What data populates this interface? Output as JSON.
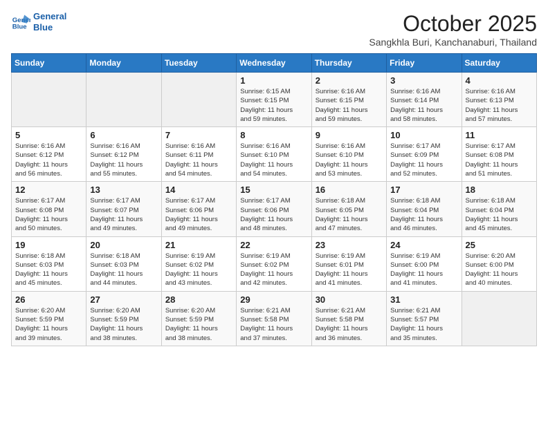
{
  "header": {
    "logo_line1": "General",
    "logo_line2": "Blue",
    "month_title": "October 2025",
    "location": "Sangkhla Buri, Kanchanaburi, Thailand"
  },
  "days_of_week": [
    "Sunday",
    "Monday",
    "Tuesday",
    "Wednesday",
    "Thursday",
    "Friday",
    "Saturday"
  ],
  "weeks": [
    [
      {
        "day": "",
        "info": ""
      },
      {
        "day": "",
        "info": ""
      },
      {
        "day": "",
        "info": ""
      },
      {
        "day": "1",
        "info": "Sunrise: 6:15 AM\nSunset: 6:15 PM\nDaylight: 11 hours\nand 59 minutes."
      },
      {
        "day": "2",
        "info": "Sunrise: 6:16 AM\nSunset: 6:15 PM\nDaylight: 11 hours\nand 59 minutes."
      },
      {
        "day": "3",
        "info": "Sunrise: 6:16 AM\nSunset: 6:14 PM\nDaylight: 11 hours\nand 58 minutes."
      },
      {
        "day": "4",
        "info": "Sunrise: 6:16 AM\nSunset: 6:13 PM\nDaylight: 11 hours\nand 57 minutes."
      }
    ],
    [
      {
        "day": "5",
        "info": "Sunrise: 6:16 AM\nSunset: 6:12 PM\nDaylight: 11 hours\nand 56 minutes."
      },
      {
        "day": "6",
        "info": "Sunrise: 6:16 AM\nSunset: 6:12 PM\nDaylight: 11 hours\nand 55 minutes."
      },
      {
        "day": "7",
        "info": "Sunrise: 6:16 AM\nSunset: 6:11 PM\nDaylight: 11 hours\nand 54 minutes."
      },
      {
        "day": "8",
        "info": "Sunrise: 6:16 AM\nSunset: 6:10 PM\nDaylight: 11 hours\nand 54 minutes."
      },
      {
        "day": "9",
        "info": "Sunrise: 6:16 AM\nSunset: 6:10 PM\nDaylight: 11 hours\nand 53 minutes."
      },
      {
        "day": "10",
        "info": "Sunrise: 6:17 AM\nSunset: 6:09 PM\nDaylight: 11 hours\nand 52 minutes."
      },
      {
        "day": "11",
        "info": "Sunrise: 6:17 AM\nSunset: 6:08 PM\nDaylight: 11 hours\nand 51 minutes."
      }
    ],
    [
      {
        "day": "12",
        "info": "Sunrise: 6:17 AM\nSunset: 6:08 PM\nDaylight: 11 hours\nand 50 minutes."
      },
      {
        "day": "13",
        "info": "Sunrise: 6:17 AM\nSunset: 6:07 PM\nDaylight: 11 hours\nand 49 minutes."
      },
      {
        "day": "14",
        "info": "Sunrise: 6:17 AM\nSunset: 6:06 PM\nDaylight: 11 hours\nand 49 minutes."
      },
      {
        "day": "15",
        "info": "Sunrise: 6:17 AM\nSunset: 6:06 PM\nDaylight: 11 hours\nand 48 minutes."
      },
      {
        "day": "16",
        "info": "Sunrise: 6:18 AM\nSunset: 6:05 PM\nDaylight: 11 hours\nand 47 minutes."
      },
      {
        "day": "17",
        "info": "Sunrise: 6:18 AM\nSunset: 6:04 PM\nDaylight: 11 hours\nand 46 minutes."
      },
      {
        "day": "18",
        "info": "Sunrise: 6:18 AM\nSunset: 6:04 PM\nDaylight: 11 hours\nand 45 minutes."
      }
    ],
    [
      {
        "day": "19",
        "info": "Sunrise: 6:18 AM\nSunset: 6:03 PM\nDaylight: 11 hours\nand 45 minutes."
      },
      {
        "day": "20",
        "info": "Sunrise: 6:18 AM\nSunset: 6:03 PM\nDaylight: 11 hours\nand 44 minutes."
      },
      {
        "day": "21",
        "info": "Sunrise: 6:19 AM\nSunset: 6:02 PM\nDaylight: 11 hours\nand 43 minutes."
      },
      {
        "day": "22",
        "info": "Sunrise: 6:19 AM\nSunset: 6:02 PM\nDaylight: 11 hours\nand 42 minutes."
      },
      {
        "day": "23",
        "info": "Sunrise: 6:19 AM\nSunset: 6:01 PM\nDaylight: 11 hours\nand 41 minutes."
      },
      {
        "day": "24",
        "info": "Sunrise: 6:19 AM\nSunset: 6:00 PM\nDaylight: 11 hours\nand 41 minutes."
      },
      {
        "day": "25",
        "info": "Sunrise: 6:20 AM\nSunset: 6:00 PM\nDaylight: 11 hours\nand 40 minutes."
      }
    ],
    [
      {
        "day": "26",
        "info": "Sunrise: 6:20 AM\nSunset: 5:59 PM\nDaylight: 11 hours\nand 39 minutes."
      },
      {
        "day": "27",
        "info": "Sunrise: 6:20 AM\nSunset: 5:59 PM\nDaylight: 11 hours\nand 38 minutes."
      },
      {
        "day": "28",
        "info": "Sunrise: 6:20 AM\nSunset: 5:59 PM\nDaylight: 11 hours\nand 38 minutes."
      },
      {
        "day": "29",
        "info": "Sunrise: 6:21 AM\nSunset: 5:58 PM\nDaylight: 11 hours\nand 37 minutes."
      },
      {
        "day": "30",
        "info": "Sunrise: 6:21 AM\nSunset: 5:58 PM\nDaylight: 11 hours\nand 36 minutes."
      },
      {
        "day": "31",
        "info": "Sunrise: 6:21 AM\nSunset: 5:57 PM\nDaylight: 11 hours\nand 35 minutes."
      },
      {
        "day": "",
        "info": ""
      }
    ]
  ]
}
